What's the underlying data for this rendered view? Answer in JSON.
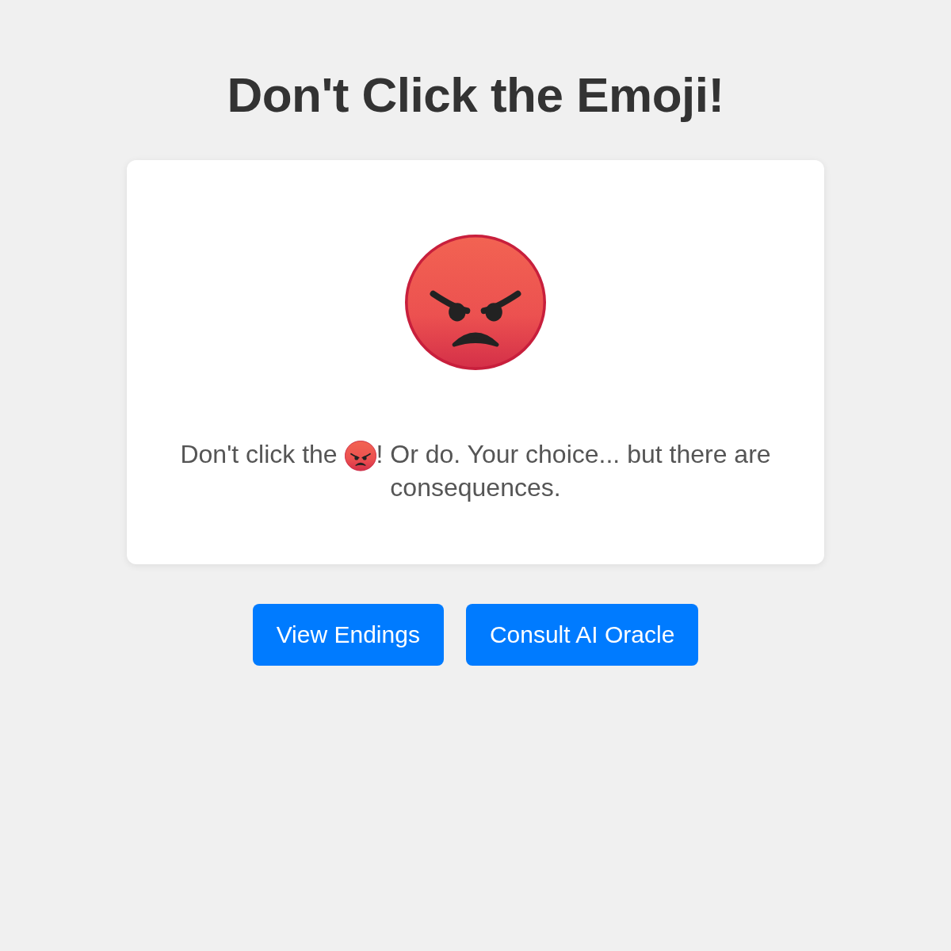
{
  "title": "Don't Click the Emoji!",
  "card": {
    "message_before": "Don't click the",
    "message_after": "! Or do. Your choice... but there are consequences."
  },
  "buttons": [
    {
      "label": "View Endings"
    },
    {
      "label": "Consult AI Oracle"
    }
  ]
}
